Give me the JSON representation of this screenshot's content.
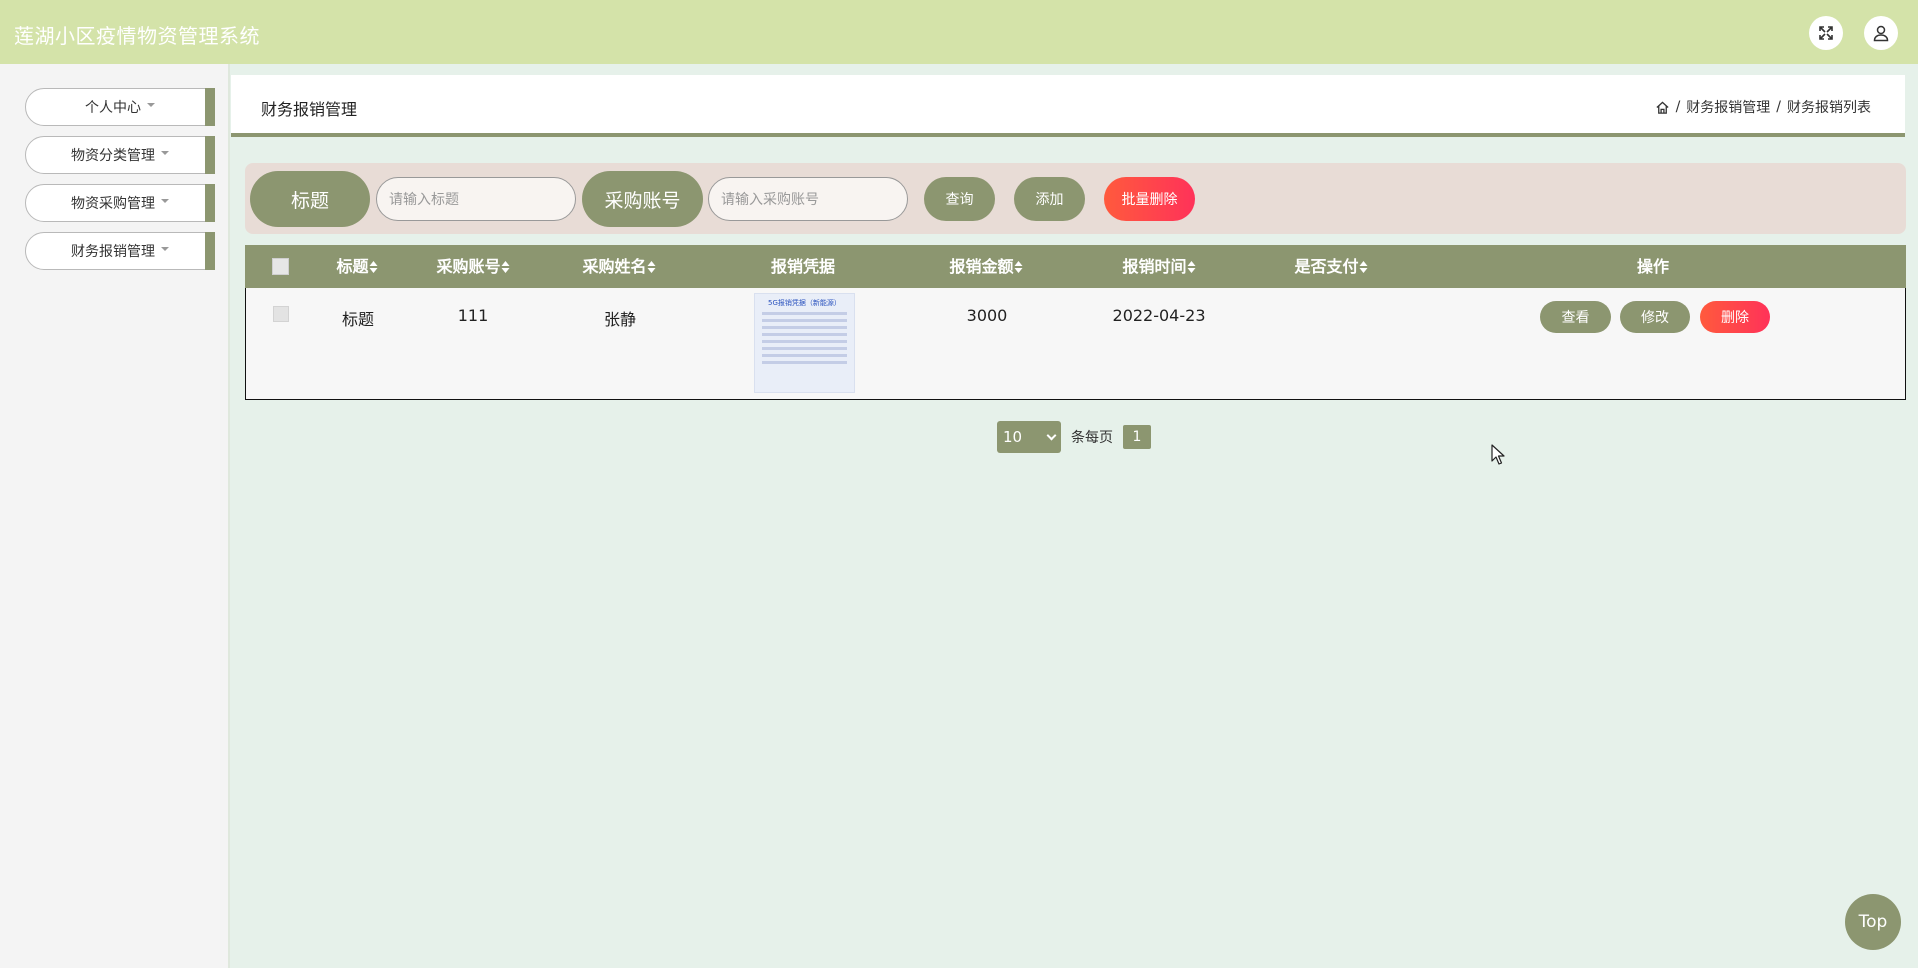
{
  "app": {
    "title": "莲湖小区疫情物资管理系统"
  },
  "header": {
    "fullscreen_icon": "expand-icon",
    "user_icon": "user-icon"
  },
  "sidebar": {
    "items": [
      {
        "label": "个人中心"
      },
      {
        "label": "物资分类管理"
      },
      {
        "label": "物资采购管理"
      },
      {
        "label": "财务报销管理"
      }
    ]
  },
  "page": {
    "title": "财务报销管理",
    "breadcrumb": {
      "home_icon": "home-icon",
      "sep": "/",
      "level1": "财务报销管理",
      "level2": "财务报销列表"
    }
  },
  "search": {
    "title_label": "标题",
    "title_placeholder": "请输入标题",
    "account_label": "采购账号",
    "account_placeholder": "请输入采购账号",
    "query_button": "查询",
    "add_button": "添加",
    "batch_delete_button": "批量删除"
  },
  "table": {
    "columns": [
      "标题",
      "采购账号",
      "采购姓名",
      "报销凭据",
      "报销金额",
      "报销时间",
      "是否支付",
      "操作"
    ],
    "rows": [
      {
        "title": "标题",
        "account": "111",
        "name": "张静",
        "receipt_caption": "5G报销凭据（新能源）",
        "amount": "3000",
        "date": "2022-04-23",
        "paid": "",
        "actions": {
          "view": "查看",
          "edit": "修改",
          "delete": "删除"
        }
      }
    ]
  },
  "pagination": {
    "page_size": "10",
    "per_page_label": "条每页",
    "current_page": "1"
  },
  "top_button": "Top",
  "colors": {
    "header_bg": "#d4e3a9",
    "accent": "#8c9670",
    "danger": "#ff3259",
    "page_bg": "#e6f1ea"
  }
}
